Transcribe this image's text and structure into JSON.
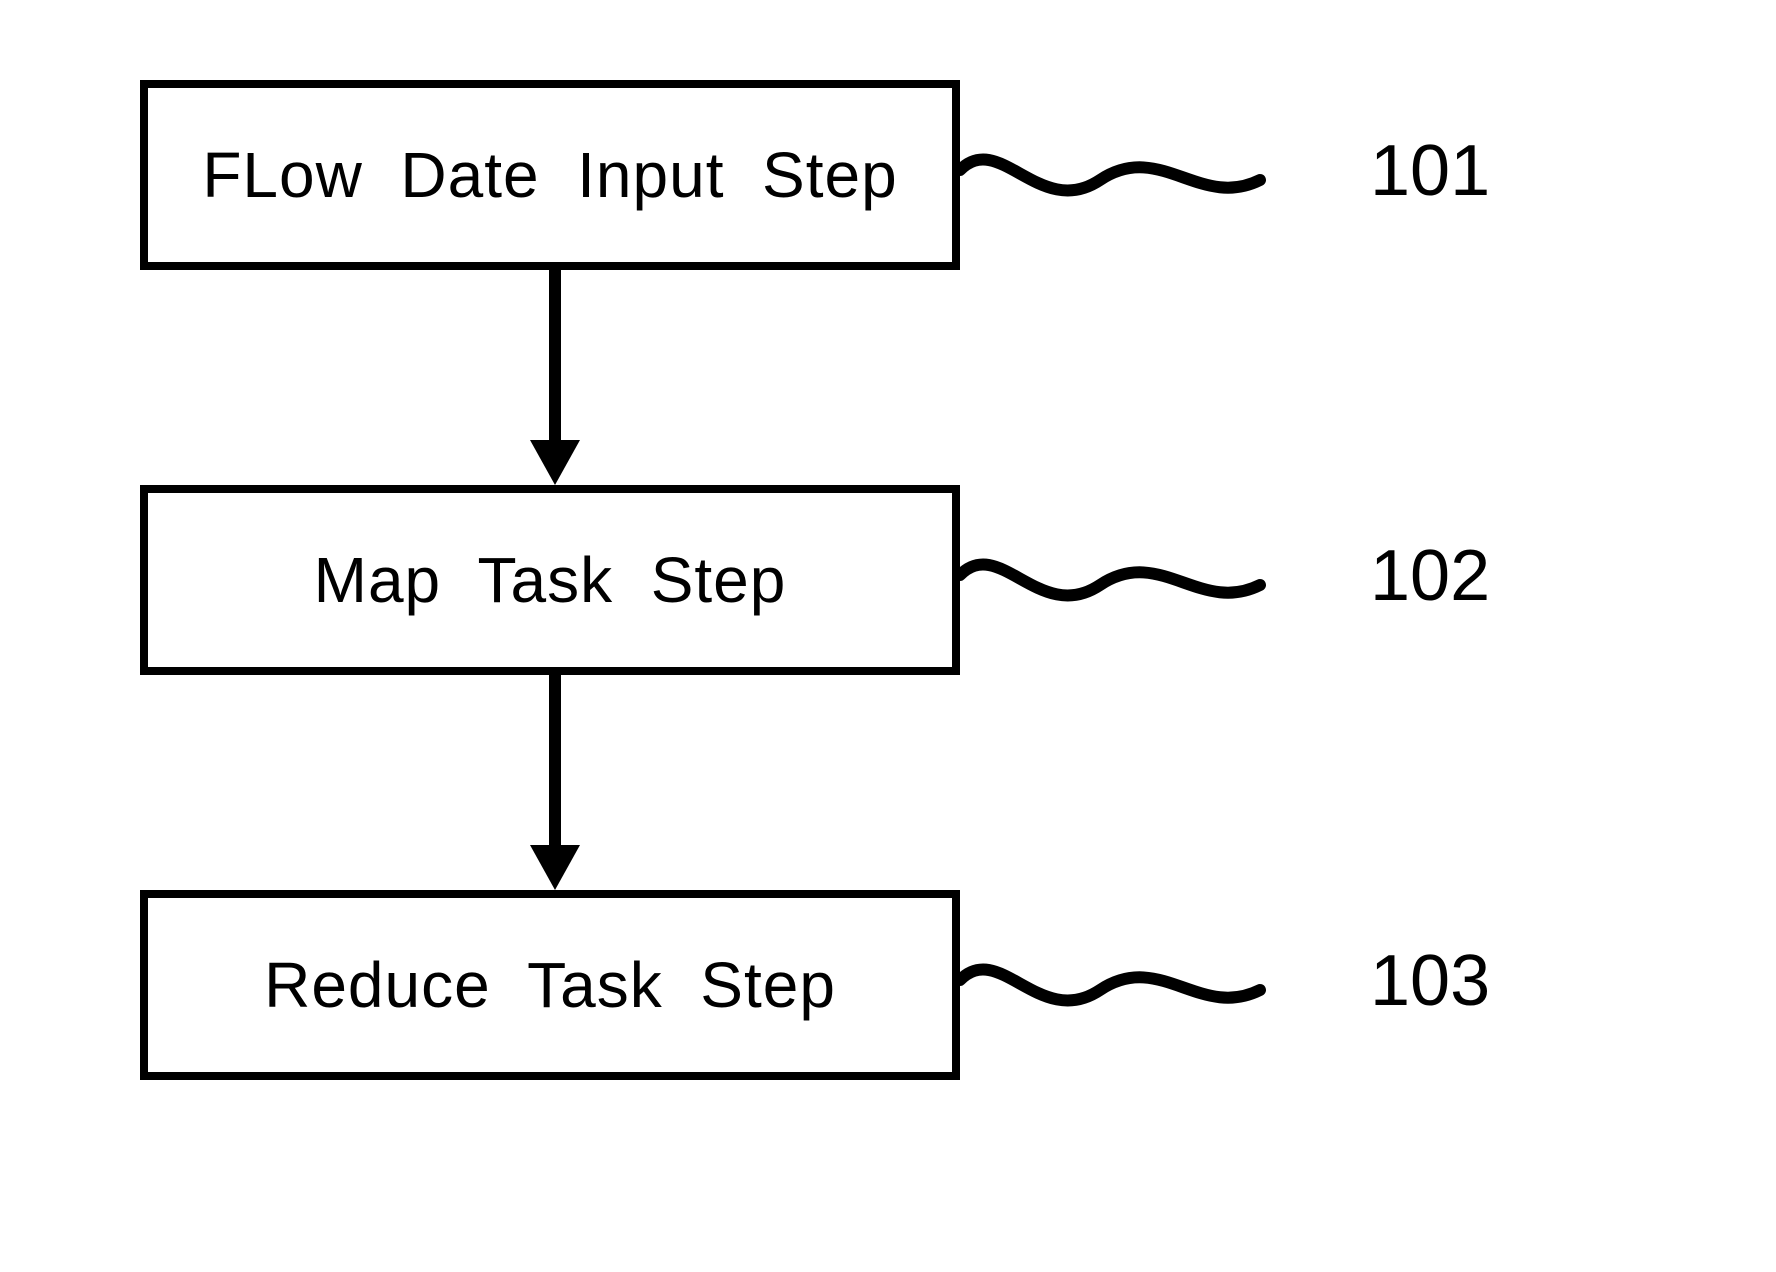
{
  "diagram": {
    "boxes": [
      {
        "id": "step-101",
        "text": "FLow  Date  Input  Step",
        "label": "101"
      },
      {
        "id": "step-102",
        "text": "Map  Task  Step",
        "label": "102"
      },
      {
        "id": "step-103",
        "text": "Reduce  Task  Step",
        "label": "103"
      }
    ]
  }
}
